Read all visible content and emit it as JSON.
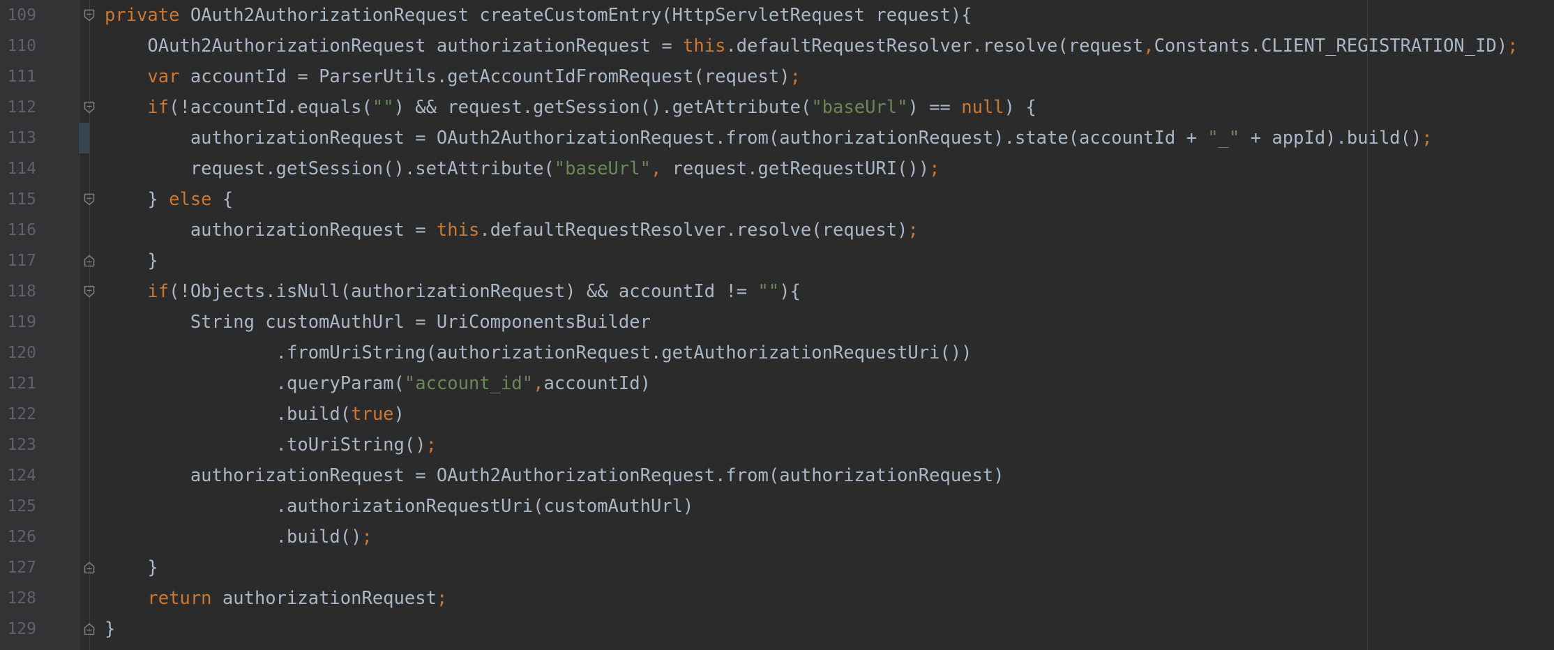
{
  "colors": {
    "background": "#2b2b2b",
    "gutter": "#313335",
    "line_number": "#606366",
    "text": "#a9b7c6",
    "keyword": "#cc7832",
    "string": "#6a8759"
  },
  "editor": {
    "lines": [
      {
        "number": "109",
        "fold": "fold-open-icon",
        "tokens": [
          {
            "t": "kw",
            "v": "private"
          },
          {
            "t": "pl",
            "v": " OAuth2AuthorizationRequest createCustomEntry(HttpServletRequest request){"
          }
        ]
      },
      {
        "number": "110",
        "tokens": [
          {
            "t": "pl",
            "v": "    OAuth2AuthorizationRequest authorizationRequest = "
          },
          {
            "t": "kw",
            "v": "this"
          },
          {
            "t": "pl",
            "v": ".defaultRequestResolver.resolve(request"
          },
          {
            "t": "kw",
            "v": ","
          },
          {
            "t": "pl",
            "v": "Constants.CLIENT_REGISTRATION_ID)"
          },
          {
            "t": "kw",
            "v": ";"
          }
        ]
      },
      {
        "number": "111",
        "tokens": [
          {
            "t": "pl",
            "v": "    "
          },
          {
            "t": "kw",
            "v": "var"
          },
          {
            "t": "pl",
            "v": " accountId = ParserUtils.getAccountIdFromRequest(request)"
          },
          {
            "t": "kw",
            "v": ";"
          }
        ]
      },
      {
        "number": "112",
        "fold": "fold-open-icon",
        "tokens": [
          {
            "t": "pl",
            "v": "    "
          },
          {
            "t": "kw",
            "v": "if"
          },
          {
            "t": "pl",
            "v": "(!accountId.equals("
          },
          {
            "t": "str",
            "v": "\"\""
          },
          {
            "t": "pl",
            "v": ") && request.getSession().getAttribute("
          },
          {
            "t": "str",
            "v": "\"baseUrl\""
          },
          {
            "t": "pl",
            "v": ") == "
          },
          {
            "t": "kw",
            "v": "null"
          },
          {
            "t": "pl",
            "v": ") {"
          }
        ]
      },
      {
        "number": "113",
        "tokens": [
          {
            "t": "pl",
            "v": "        authorizationRequest = OAuth2AuthorizationRequest.from(authorizationRequest).state(accountId + "
          },
          {
            "t": "str",
            "v": "\"_\""
          },
          {
            "t": "pl",
            "v": " + appId).build()"
          },
          {
            "t": "kw",
            "v": ";"
          }
        ]
      },
      {
        "number": "114",
        "tokens": [
          {
            "t": "pl",
            "v": "        request.getSession().setAttribute("
          },
          {
            "t": "str",
            "v": "\"baseUrl\""
          },
          {
            "t": "kw",
            "v": ","
          },
          {
            "t": "pl",
            "v": " request.getRequestURI())"
          },
          {
            "t": "kw",
            "v": ";"
          }
        ]
      },
      {
        "number": "115",
        "fold": "fold-open-icon",
        "tokens": [
          {
            "t": "pl",
            "v": "    } "
          },
          {
            "t": "kw",
            "v": "else"
          },
          {
            "t": "pl",
            "v": " {"
          }
        ]
      },
      {
        "number": "116",
        "tokens": [
          {
            "t": "pl",
            "v": "        authorizationRequest = "
          },
          {
            "t": "kw",
            "v": "this"
          },
          {
            "t": "pl",
            "v": ".defaultRequestResolver.resolve(request)"
          },
          {
            "t": "kw",
            "v": ";"
          }
        ]
      },
      {
        "number": "117",
        "fold": "fold-end-icon",
        "tokens": [
          {
            "t": "pl",
            "v": "    }"
          }
        ]
      },
      {
        "number": "118",
        "fold": "fold-open-icon",
        "tokens": [
          {
            "t": "pl",
            "v": "    "
          },
          {
            "t": "kw",
            "v": "if"
          },
          {
            "t": "pl",
            "v": "(!Objects.isNull(authorizationRequest) && accountId != "
          },
          {
            "t": "str",
            "v": "\"\""
          },
          {
            "t": "pl",
            "v": "){"
          }
        ]
      },
      {
        "number": "119",
        "tokens": [
          {
            "t": "pl",
            "v": "        String customAuthUrl = UriComponentsBuilder"
          }
        ]
      },
      {
        "number": "120",
        "tokens": [
          {
            "t": "pl",
            "v": "                .fromUriString(authorizationRequest.getAuthorizationRequestUri())"
          }
        ]
      },
      {
        "number": "121",
        "tokens": [
          {
            "t": "pl",
            "v": "                .queryParam("
          },
          {
            "t": "str",
            "v": "\"account_id\""
          },
          {
            "t": "kw",
            "v": ","
          },
          {
            "t": "pl",
            "v": "accountId)"
          }
        ]
      },
      {
        "number": "122",
        "tokens": [
          {
            "t": "pl",
            "v": "                .build("
          },
          {
            "t": "kw",
            "v": "true"
          },
          {
            "t": "pl",
            "v": ")"
          }
        ]
      },
      {
        "number": "123",
        "tokens": [
          {
            "t": "pl",
            "v": "                .toUriString()"
          },
          {
            "t": "kw",
            "v": ";"
          }
        ]
      },
      {
        "number": "124",
        "tokens": [
          {
            "t": "pl",
            "v": "        authorizationRequest = OAuth2AuthorizationRequest.from(authorizationRequest)"
          }
        ]
      },
      {
        "number": "125",
        "tokens": [
          {
            "t": "pl",
            "v": "                .authorizationRequestUri(customAuthUrl)"
          }
        ]
      },
      {
        "number": "126",
        "tokens": [
          {
            "t": "pl",
            "v": "                .build()"
          },
          {
            "t": "kw",
            "v": ";"
          }
        ]
      },
      {
        "number": "127",
        "fold": "fold-end-icon",
        "tokens": [
          {
            "t": "pl",
            "v": "    }"
          }
        ]
      },
      {
        "number": "128",
        "tokens": [
          {
            "t": "pl",
            "v": "    "
          },
          {
            "t": "kw",
            "v": "return"
          },
          {
            "t": "pl",
            "v": " authorizationRequest"
          },
          {
            "t": "kw",
            "v": ";"
          }
        ]
      },
      {
        "number": "129",
        "fold": "fold-end-icon",
        "tokens": [
          {
            "t": "pl",
            "v": "}"
          }
        ]
      }
    ]
  }
}
